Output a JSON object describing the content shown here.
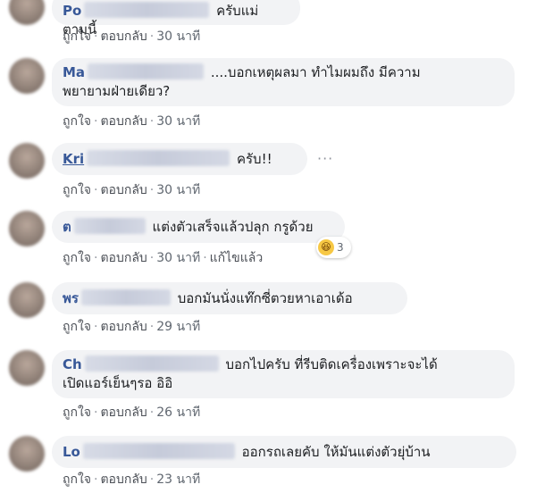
{
  "labels": {
    "like": "ถูกใจ",
    "reply": "ตอบกลับ",
    "edited": "แก้ไขแล้ว",
    "separator": "·"
  },
  "comments": [
    {
      "author": "Po",
      "text": "ครับแม่ ตามนี้",
      "time": "30 นาที"
    },
    {
      "author": "Ma",
      "text": "....บอกเหตุผลมา ทำไมผมถึง มีความ",
      "text2": "พยายามฝ่ายเดียว?",
      "time": "30 นาที"
    },
    {
      "author": "Kri",
      "text": "ครับ!!",
      "time": "30 นาที",
      "more": "···"
    },
    {
      "author": "ต",
      "text": "แต่งตัวเสร็จแล้วปลุก กรูด้วย",
      "time": "30 นาที",
      "reaction_count": "3"
    },
    {
      "author": "พร",
      "text": "บอกมันนั่งแท๊กซี่ตวยหาเอาเด้อ",
      "time": "29 นาที"
    },
    {
      "author": "Ch",
      "text": "บอกไปครับ ที่รีบติดเครื่องเพราะจะได้",
      "text2": "เปิดแอร์เย็นๆรอ อิอิ",
      "time": "26 นาที"
    },
    {
      "author": "Lo",
      "text": "ออกรถเลยคับ ให้มันแต่งตัวยุ่บ้าน",
      "time": "23 นาที"
    }
  ]
}
